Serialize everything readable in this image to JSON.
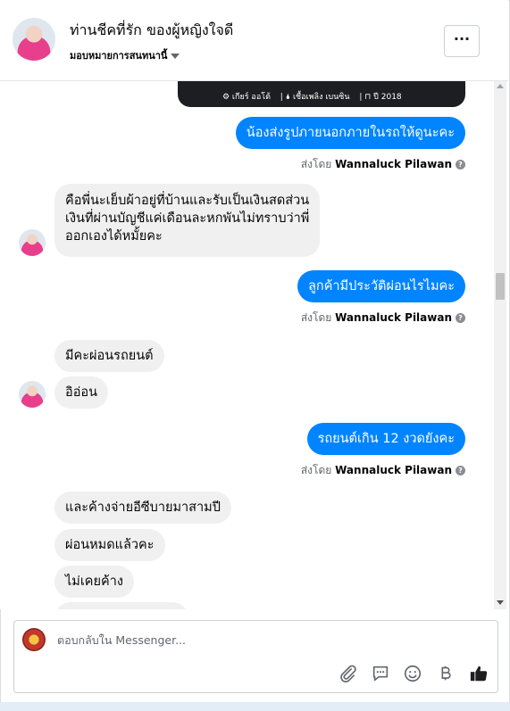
{
  "header": {
    "title": "ท่านชีคที่รัก ของผู้หญิงใจดี",
    "assign_label": "มอบหมายการสนทนานี้",
    "more_label": "···"
  },
  "card": {
    "meta": [
      "⚙ เกียร์ ออโต้",
      "| 🌢 เชื้อเพลิง เบนซิน",
      "| ⊓ ปี 2018"
    ]
  },
  "messages": [
    {
      "dir": "out",
      "text": "น้องส่งรูปภายนอกภายในรถให้ดูนะคะ"
    },
    {
      "dir": "in",
      "lines": [
        "คือพี่นะเย็บผ้าอยู่ที่บ้านและรับเป็นเงินสดส่วน",
        "เงินที่ผ่านบัญชีแค่เดือนละหกพันไม่ทราบว่าพี่",
        "ออกเองได้หมั้ยคะ"
      ]
    },
    {
      "dir": "out",
      "text": "ลูกค้ามีประวัติผ่อนไรไมคะ"
    },
    {
      "dir": "in",
      "text": "มีคะผ่อนรถยนต์"
    },
    {
      "dir": "in",
      "text": "อิอ่อน"
    },
    {
      "dir": "out",
      "text": "รถยนต์เกิน 12 งวดยังคะ"
    },
    {
      "dir": "in",
      "text": "และค้างจ่ายอีซีบายมาสามปี"
    },
    {
      "dir": "in",
      "text": "ผ่อนหมดแล้วคะ"
    },
    {
      "dir": "in",
      "text": "ไม่เคยค้าง"
    }
  ],
  "sent_by": {
    "prefix": "ส่งโดย",
    "name": "Wannaluck Pilawan",
    "help": "?"
  },
  "composer": {
    "placeholder": "ตอบกลับใน Messenger..."
  },
  "icons": [
    "paperclip-icon",
    "chat-bubble-icon",
    "emoji-icon",
    "baht-icon",
    "thumbs-up-icon"
  ],
  "colors": {
    "outgoing": "#0084ff",
    "incoming": "#f0f0f0",
    "like": "#1c1e21"
  }
}
